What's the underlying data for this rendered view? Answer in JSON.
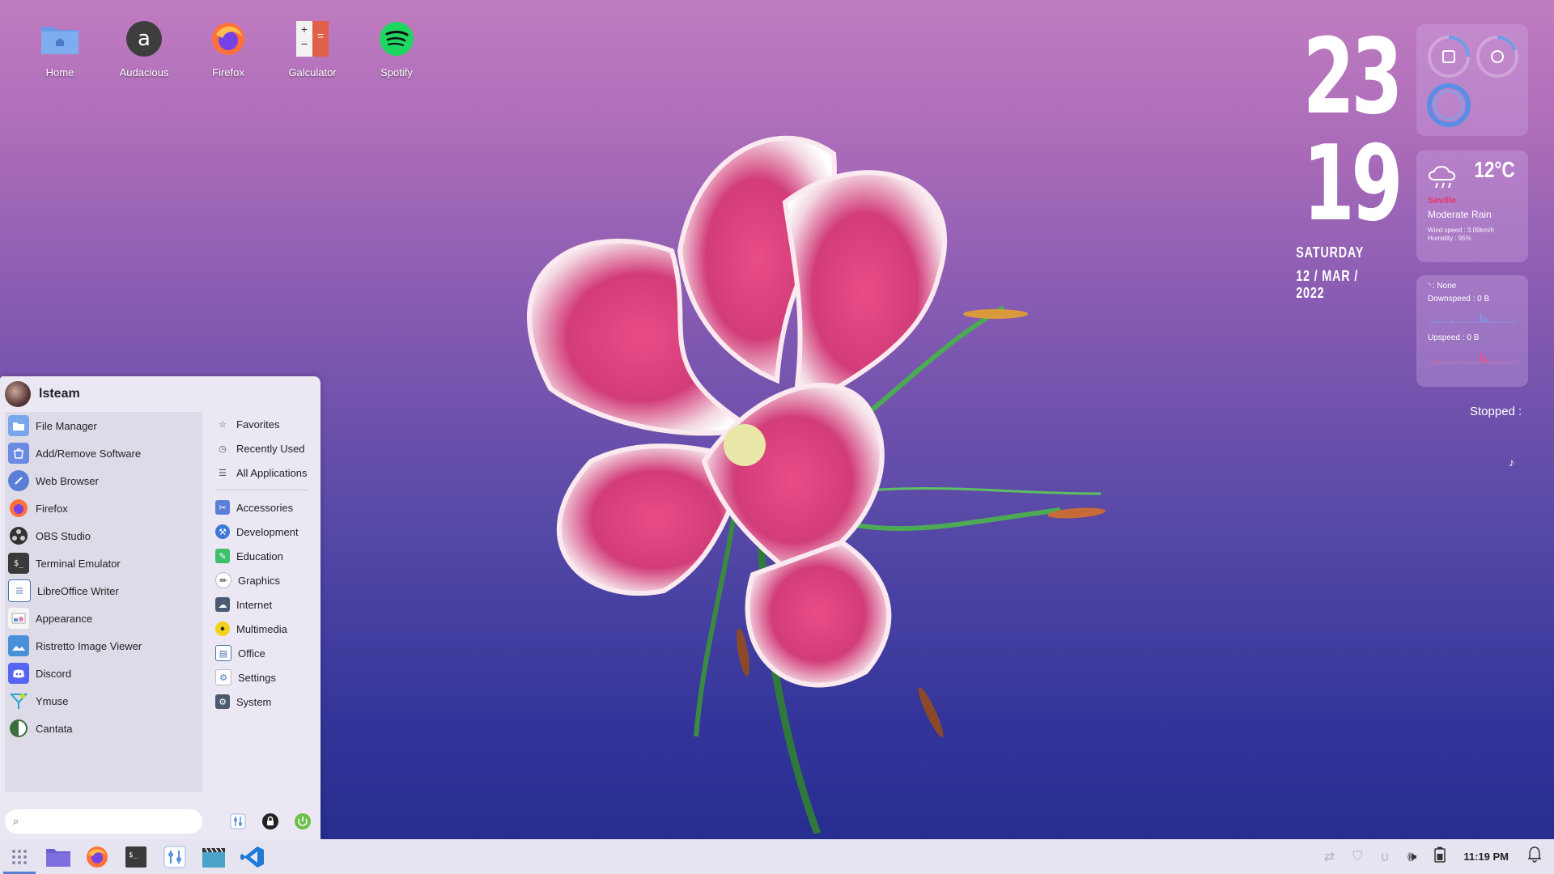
{
  "desktop": {
    "icons": [
      {
        "label": "Home",
        "icon": "home-folder-icon"
      },
      {
        "label": "Audacious",
        "icon": "audacious-icon"
      },
      {
        "label": "Firefox",
        "icon": "firefox-icon"
      },
      {
        "label": "Galculator",
        "icon": "calculator-icon"
      },
      {
        "label": "Spotify",
        "icon": "spotify-icon"
      }
    ]
  },
  "clock": {
    "hour": "23",
    "minute": "19",
    "weekday": "SATURDAY",
    "date": "12 / MAR / 2022"
  },
  "weather": {
    "temp": "12°C",
    "city": "Seville",
    "condition": "Moderate Rain",
    "wind": "Wind speed : 3.09km/h",
    "humidity": "Humidity : 95%"
  },
  "network": {
    "iface": ": None",
    "down": "Downspeed : 0 B",
    "up": "Upspeed : 0 B"
  },
  "music": {
    "status": "Stopped :",
    "note": "♪"
  },
  "menu": {
    "user": "lsteam",
    "apps": [
      {
        "label": "File Manager",
        "icon": "file-manager-icon",
        "color": "#5b8fe0"
      },
      {
        "label": "Add/Remove Software",
        "icon": "software-icon",
        "color": "#6a8be0"
      },
      {
        "label": "Web Browser",
        "icon": "web-browser-icon",
        "color": "#5b7fd6"
      },
      {
        "label": "Firefox",
        "icon": "firefox-icon",
        "color": "#ff7139"
      },
      {
        "label": "OBS Studio",
        "icon": "obs-icon",
        "color": "#333333"
      },
      {
        "label": "Terminal Emulator",
        "icon": "terminal-icon",
        "color": "#3a3a3a"
      },
      {
        "label": "LibreOffice Writer",
        "icon": "writer-icon",
        "color": "#ffffff"
      },
      {
        "label": "Appearance",
        "icon": "appearance-icon",
        "color": "#e8e8e8"
      },
      {
        "label": "Ristretto Image Viewer",
        "icon": "image-viewer-icon",
        "color": "#4a90d9"
      },
      {
        "label": "Discord",
        "icon": "discord-icon",
        "color": "#5865f2"
      },
      {
        "label": "Ymuse",
        "icon": "ymuse-icon",
        "color": "#dedbe9"
      },
      {
        "label": "Cantata",
        "icon": "cantata-icon",
        "color": "#3b6e3b"
      }
    ],
    "top_categories": [
      {
        "label": "Favorites",
        "icon": "star-icon"
      },
      {
        "label": "Recently Used",
        "icon": "clock-icon"
      },
      {
        "label": "All Applications",
        "icon": "list-icon"
      }
    ],
    "categories": [
      {
        "label": "Accessories",
        "icon": "accessories-icon",
        "color": "#5b7fd6"
      },
      {
        "label": "Development",
        "icon": "development-icon",
        "color": "#3b78d8"
      },
      {
        "label": "Education",
        "icon": "education-icon",
        "color": "#3fbf6a"
      },
      {
        "label": "Graphics",
        "icon": "graphics-icon",
        "color": "#ffffff"
      },
      {
        "label": "Internet",
        "icon": "internet-icon",
        "color": "#4b5a6e"
      },
      {
        "label": "Multimedia",
        "icon": "multimedia-icon",
        "color": "#f2d21b"
      },
      {
        "label": "Office",
        "icon": "office-icon",
        "color": "#ffffff"
      },
      {
        "label": "Settings",
        "icon": "settings-icon",
        "color": "#ffffff"
      },
      {
        "label": "System",
        "icon": "system-icon",
        "color": "#4b5a6e"
      }
    ],
    "search_placeholder": ""
  },
  "taskbar": {
    "time": "11:19 PM",
    "apps": [
      "app-grid-icon",
      "files-icon",
      "firefox-icon",
      "terminal-icon",
      "settings-icon",
      "video-icon",
      "vscode-icon"
    ]
  }
}
